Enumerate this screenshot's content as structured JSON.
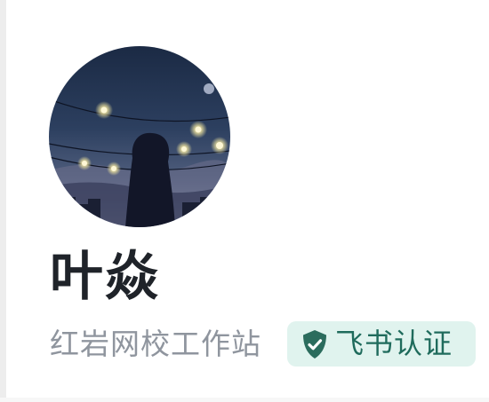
{
  "profile": {
    "name": "叶焱",
    "organization": "红岩网校工作站",
    "verification_badge": "飞书认证"
  },
  "colors": {
    "name_text": "#1f2329",
    "organization_text": "#8f959e",
    "badge_background": "#e0f3ee",
    "badge_text": "#1f6b5c",
    "badge_icon": "#2b6c5d"
  },
  "icons": {
    "badge_icon": "verified-shield-check-icon"
  }
}
